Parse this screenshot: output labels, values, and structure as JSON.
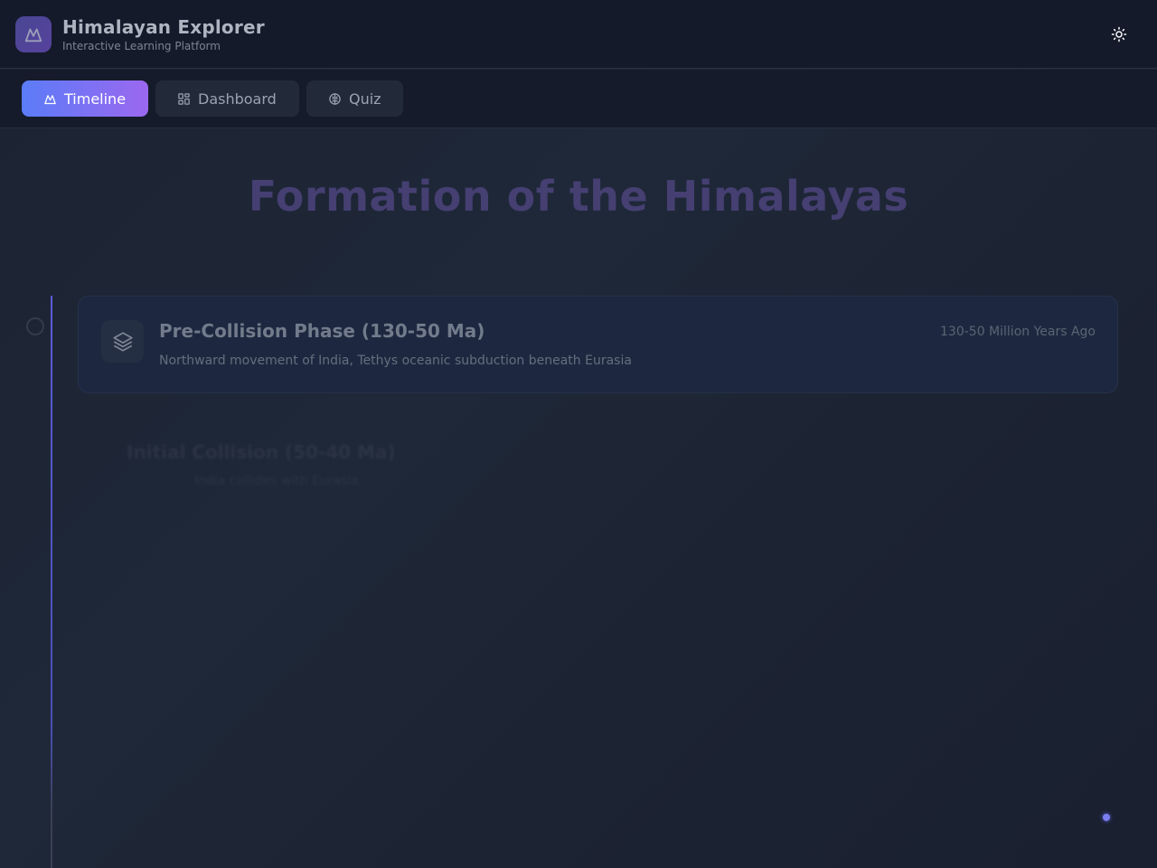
{
  "header": {
    "app_title": "Himalayan Explorer",
    "app_subtitle": "Interactive Learning Platform",
    "logo_icon": "mountain-icon",
    "theme_toggle_icon": "sun-icon"
  },
  "nav": {
    "tabs": [
      {
        "label": "Timeline",
        "icon": "mountain-icon",
        "active": true
      },
      {
        "label": "Dashboard",
        "icon": "grid-icon",
        "active": false
      },
      {
        "label": "Quiz",
        "icon": "brain-icon",
        "active": false
      }
    ]
  },
  "main": {
    "title": "Formation of the Himalayas",
    "timeline": [
      {
        "title": "Pre-Collision Phase (130-50 Ma)",
        "date": "130-50 Million Years Ago",
        "description": "Northward movement of India, Tethys oceanic subduction beneath Eurasia",
        "icon": "layers-icon"
      },
      {
        "title": "Initial Collision (50-40 Ma)",
        "date": "",
        "description": "India collides with Eurasia",
        "icon": ""
      }
    ]
  },
  "colors": {
    "accent_start": "#5b7cf7",
    "accent_end": "#9b68f0",
    "background": "#1c2333"
  }
}
